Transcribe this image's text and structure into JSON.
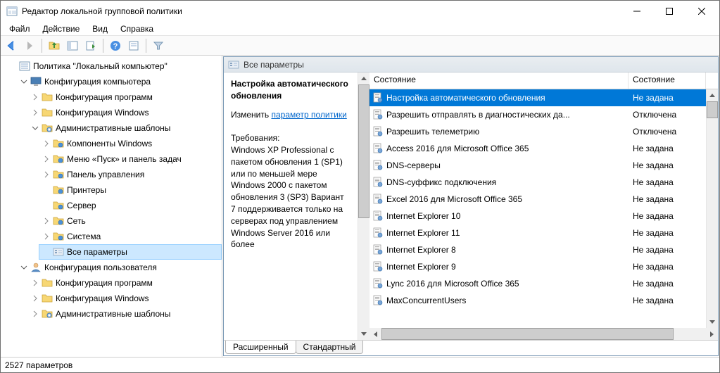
{
  "window": {
    "title": "Редактор локальной групповой политики"
  },
  "menu": {
    "file": "Файл",
    "action": "Действие",
    "view": "Вид",
    "help": "Справка"
  },
  "tree": {
    "root": "Политика \"Локальный компьютер\"",
    "computer_cfg": "Конфигурация компьютера",
    "cc_programs": "Конфигурация программ",
    "cc_windows": "Конфигурация Windows",
    "cc_admin_templates": "Административные шаблоны",
    "at_win_components": "Компоненты Windows",
    "at_start_menu": "Меню «Пуск» и панель задач",
    "at_control_panel": "Панель управления",
    "at_printers": "Принтеры",
    "at_server": "Сервер",
    "at_network": "Сеть",
    "at_system": "Система",
    "at_all_settings": "Все параметры",
    "user_cfg": "Конфигурация пользователя",
    "uc_programs": "Конфигурация программ",
    "uc_windows": "Конфигурация Windows",
    "uc_admin_templates": "Административные шаблоны"
  },
  "rheader": {
    "title": "Все параметры"
  },
  "desc": {
    "title": "Настройка автоматического обновления",
    "edit_prefix": "Изменить ",
    "edit_link": "параметр политики",
    "req_label": "Требования:",
    "req_text": "Windows XP Professional с пакетом обновления 1 (SP1) или по меньшей мере Windows 2000 с пакетом обновления 3 (SP3) Вариант 7 поддерживается только на серверах под управлением Windows Server 2016 или более"
  },
  "list": {
    "col_a": "Состояние",
    "col_b": "Состояние",
    "rows": [
      {
        "name": "Настройка автоматического обновления",
        "state": "Не задана",
        "selected": true
      },
      {
        "name": "Разрешить отправлять в диагностических да...",
        "state": "Отключена"
      },
      {
        "name": "Разрешить телеметрию",
        "state": "Отключена"
      },
      {
        "name": "Access 2016 для Microsoft Office 365",
        "state": "Не задана"
      },
      {
        "name": "DNS-серверы",
        "state": "Не задана"
      },
      {
        "name": "DNS-суффикс подключения",
        "state": "Не задана"
      },
      {
        "name": "Excel 2016 для Microsoft Office 365",
        "state": "Не задана"
      },
      {
        "name": "Internet Explorer 10",
        "state": "Не задана"
      },
      {
        "name": "Internet Explorer 11",
        "state": "Не задана"
      },
      {
        "name": "Internet Explorer 8",
        "state": "Не задана"
      },
      {
        "name": "Internet Explorer 9",
        "state": "Не задана"
      },
      {
        "name": "Lync 2016 для Microsoft Office 365",
        "state": "Не задана"
      },
      {
        "name": "MaxConcurrentUsers",
        "state": "Не задана"
      }
    ]
  },
  "tabs": {
    "extended": "Расширенный",
    "standard": "Стандартный"
  },
  "status": {
    "text": "2527 параметров"
  }
}
